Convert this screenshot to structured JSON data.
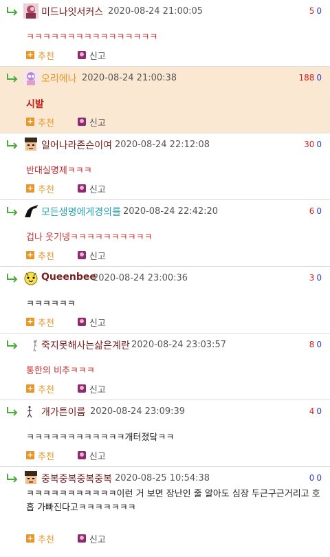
{
  "comments": [
    {
      "nick": "미드나잇서커스",
      "date": "2020-08-24 21:00:05",
      "up": "5",
      "down": "0",
      "text": "ㅋㅋㅋㅋㅋㅋㅋㅋㅋㅋㅋㅋㅋㅋㅋㅋ",
      "avatar": "anime-avatar-icon",
      "highlight": false
    },
    {
      "nick": "오리에나",
      "date": "2020-08-24 21:00:38",
      "up": "188",
      "down": "0",
      "text": "시발",
      "avatar": "anime-avatar-icon",
      "highlight": true
    },
    {
      "nick": "일어나라존슨이여",
      "date": "2020-08-24 22:12:08",
      "up": "30",
      "down": "0",
      "text": "반대실명제ㅋㅋㅋ",
      "avatar": "pixel-face-avatar-icon",
      "highlight": false
    },
    {
      "nick": "모든생명에게경의를",
      "date": "2020-08-24 22:42:20",
      "up": "6",
      "down": "0",
      "text": "겁나 웃기넹ㅋㅋㅋㅋㅋㅋㅋㅋㅋㅋ",
      "avatar": "dino-silhouette-avatar-icon",
      "highlight": false
    },
    {
      "nick": "Queenbee",
      "date": "2020-08-24 23:00:36",
      "up": "3",
      "down": "0",
      "text": "ㅋㅋㅋㅋㅋㅋ",
      "avatar": "yellow-character-avatar-icon",
      "highlight": false
    },
    {
      "nick": "죽지못해사는삶은계란",
      "date": "2020-08-24 23:03:57",
      "up": "8",
      "down": "0",
      "text": "통한의 비추ㅋㅋㅋ",
      "avatar": "small-figure-avatar-icon",
      "highlight": false
    },
    {
      "nick": "개가튼이름",
      "date": "2020-08-24 23:09:39",
      "up": "4",
      "down": "0",
      "text": "ㅋㅋㅋㅋㅋㅋㅋㅋㅋㅋㅋㅋ개터졌닼ㅋㅋ",
      "avatar": "tiny-figure-avatar-icon",
      "highlight": false
    },
    {
      "nick": "중복중복중복중복",
      "date": "2020-08-25 10:54:38",
      "up": "0",
      "down": "0",
      "text": "ㅋㅋㅋㅋㅋㅋㅋㅋㅋㅋㅋ이런 거 보면 장난인 줄 알아도 심장 두근구근거리고 호흡 가빠진다고ㅋㅋㅋㅋㅋㅋㅋ",
      "avatar": "pixel-face-avatar-icon",
      "highlight": false
    }
  ],
  "actions": {
    "recommend_icon": "+",
    "recommend": "추천",
    "report": "신고"
  },
  "colors": {
    "highlight_bg": "#fbe8d3",
    "upvote": "#d42020",
    "downvote": "#2a3bd4",
    "recommend": "#e8962a",
    "nick_teal": "#2ba4b3"
  }
}
